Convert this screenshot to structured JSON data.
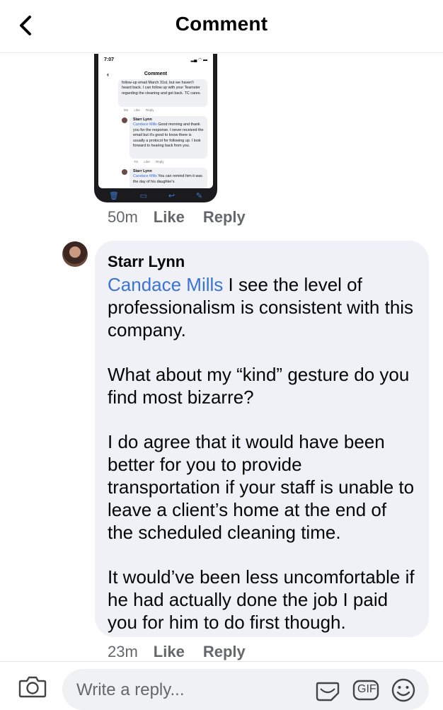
{
  "header": {
    "title": "Comment"
  },
  "attachment": {
    "status_time": "7:07",
    "title": "Comment",
    "first_text": "follow-up email March 31st, but we haven't heard back. I can follow up with your Teamster regarding the cleaning and get back. TC cares.",
    "first_meta": {
      "time": "9m",
      "like": "Like",
      "reply": "Reply"
    },
    "second_author": "Starr Lynn",
    "second_mention": "Candace Mills",
    "second_text": "Good morning and thank you for the response. I never received the email but it's good to know there is usually a protocol for following up. I look forward to hearing back from you.",
    "second_meta": {
      "time": "7m",
      "like": "Like",
      "reply": "Reply"
    },
    "third_author": "Starr Lynn",
    "third_mention": "Candace Mills",
    "third_text": "You can remind him it was the day of his daughter's"
  },
  "first_comment_meta": {
    "time": "50m",
    "like": "Like",
    "reply": "Reply"
  },
  "comment": {
    "author": "Starr Lynn",
    "mention": "Candace Mills",
    "paragraph1": "I see the level of professionalism is consistent with this company.",
    "paragraph2": "What about my “kind” gesture do you find most bizarre?",
    "paragraph3": "I do agree that it would have been better for you to provide transportation if your staff is unable to leave a client’s home at the end of the scheduled cleaning time.",
    "paragraph4": "It would’ve been less uncomfortable if he had actually done the job I paid you for him to do first though.",
    "meta": {
      "time": "23m",
      "like": "Like",
      "reply": "Reply"
    }
  },
  "composer": {
    "placeholder": "Write a reply...",
    "gif_label": "GIF",
    "icons": [
      "camera-icon",
      "sticker-icon",
      "gif-icon",
      "emoji-icon",
      "back-chevron-icon"
    ]
  },
  "colors": {
    "mention": "#3b72d6",
    "bubble": "#f0f1f6",
    "meta": "#65676b"
  }
}
